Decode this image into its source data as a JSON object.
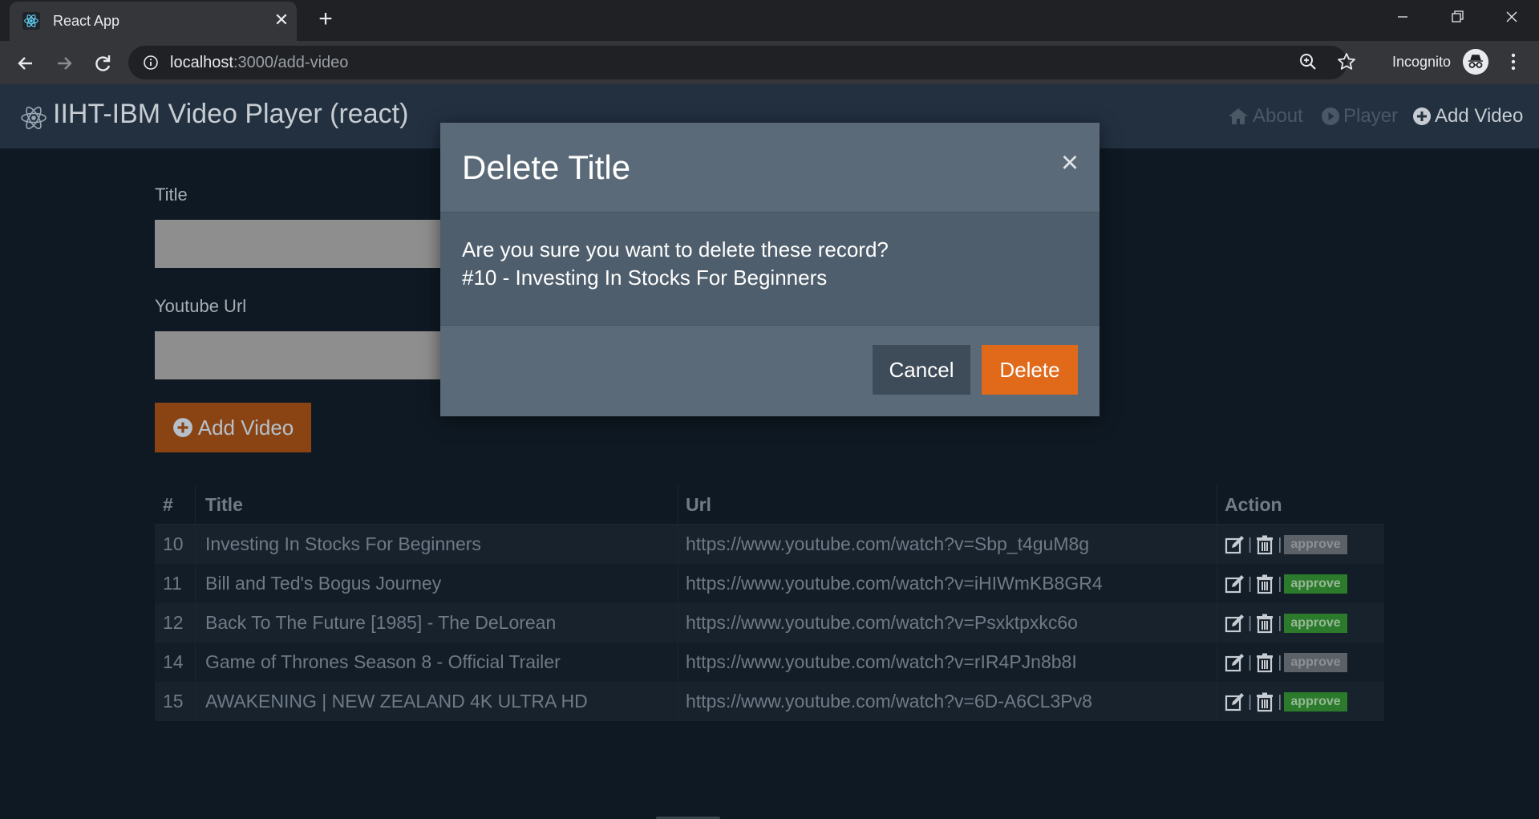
{
  "browser": {
    "tab_title": "React App",
    "url_host": "localhost",
    "url_rest": ":3000/add-video",
    "incognito_label": "Incognito"
  },
  "app": {
    "brand": "IIHT-IBM Video Player (react)",
    "nav": {
      "about": "About",
      "player": "Player",
      "add_video": "Add Video"
    }
  },
  "form": {
    "title_label": "Title",
    "url_label": "Youtube Url",
    "add_button": "Add Video"
  },
  "table": {
    "headers": {
      "id": "#",
      "title": "Title",
      "url": "Url",
      "action": "Action"
    },
    "rows": [
      {
        "id": "10",
        "title": "Investing In Stocks For Beginners",
        "url": "https://www.youtube.com/watch?v=Sbp_t4guM8g",
        "status": "approve",
        "approved": false
      },
      {
        "id": "11",
        "title": "Bill and Ted's Bogus Journey",
        "url": "https://www.youtube.com/watch?v=iHIWmKB8GR4",
        "status": "approve",
        "approved": true
      },
      {
        "id": "12",
        "title": "Back To The Future [1985] - The DeLorean",
        "url": "https://www.youtube.com/watch?v=Psxktpxkc6o",
        "status": "approve",
        "approved": true
      },
      {
        "id": "14",
        "title": "Game of Thrones Season 8 - Official Trailer",
        "url": "https://www.youtube.com/watch?v=rIR4PJn8b8I",
        "status": "approve",
        "approved": false
      },
      {
        "id": "15",
        "title": "AWAKENING | NEW ZEALAND 4K ULTRA HD",
        "url": "https://www.youtube.com/watch?v=6D-A6CL3Pv8",
        "status": "approve",
        "approved": true
      }
    ]
  },
  "modal": {
    "title": "Delete Title",
    "close": "×",
    "message": "Are you sure you want to delete these record?",
    "record": "#10 - Investing In Stocks For Beginners",
    "cancel": "Cancel",
    "delete": "Delete"
  },
  "colors": {
    "accent_orange": "#e0691a",
    "approve_green": "#2c7a2c"
  }
}
